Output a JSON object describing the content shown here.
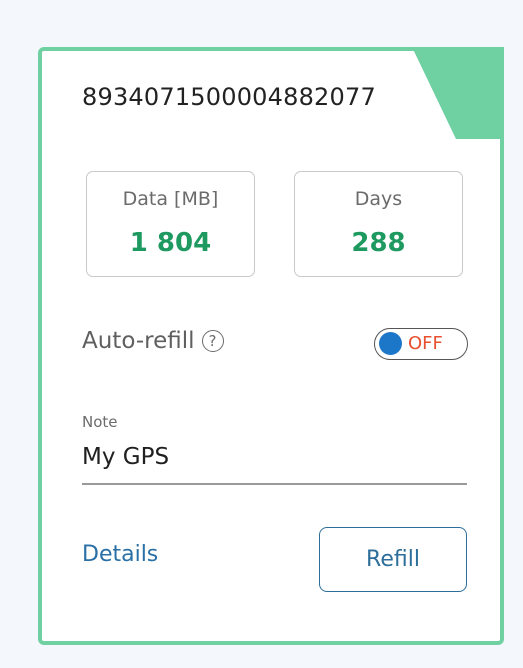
{
  "card": {
    "iccid": "8934071500004882077",
    "accent_color": "#6fd0a1"
  },
  "stats": {
    "data": {
      "label": "Data [MB]",
      "value": "1 804"
    },
    "days": {
      "label": "Days",
      "value": "288"
    },
    "value_color": "#1e9a60"
  },
  "auto_refill": {
    "label": "Auto-refill",
    "help_icon": "question-circle-icon",
    "help_glyph": "?",
    "toggle_state": "OFF"
  },
  "note": {
    "label": "Note",
    "value": "My GPS"
  },
  "actions": {
    "details_label": "Details",
    "refill_label": "Refill"
  }
}
